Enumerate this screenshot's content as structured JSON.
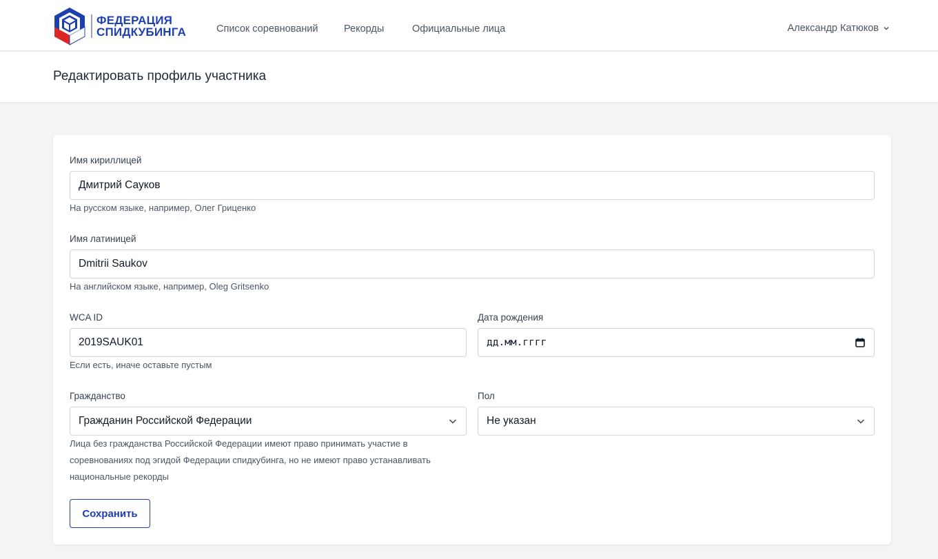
{
  "navbar": {
    "logo": {
      "line1": "ФЕДЕРАЦИЯ",
      "line2": "СПИДКУБИНГА"
    },
    "links": [
      {
        "label": "Список соревнований"
      },
      {
        "label": "Рекорды"
      },
      {
        "label": "Официальные лица"
      }
    ],
    "user_name": "Александр Катюков",
    "accent_color": "#1e40af"
  },
  "page": {
    "title": "Редактировать профиль участника"
  },
  "form": {
    "name_cyrillic": {
      "label": "Имя кириллицей",
      "value": "Дмитрий Сауков",
      "hint": "На русском языке, например, Олег Гриценко"
    },
    "name_latin": {
      "label": "Имя латиницей",
      "value": "Dmitrii Saukov",
      "hint": "На английском языке, например, Oleg Gritsenko"
    },
    "wca_id": {
      "label": "WCA ID",
      "value": "2019SAUK01",
      "hint": "Если есть, иначе оставьте пустым"
    },
    "birth_date": {
      "label": "Дата рождения",
      "placeholder": "дд.мм.гггг"
    },
    "citizenship": {
      "label": "Гражданство",
      "selected": "Гражданин Российской Федерации",
      "hint_lines": [
        "Лица без гражданства Российской Федерации имеют право принимать участие в",
        "соревнованиях под эгидой Федерации спидкубинга, но не имеют право устанавливать",
        "национальные рекорды"
      ]
    },
    "gender": {
      "label": "Пол",
      "selected": "Не указан"
    },
    "save_label": "Сохранить"
  }
}
